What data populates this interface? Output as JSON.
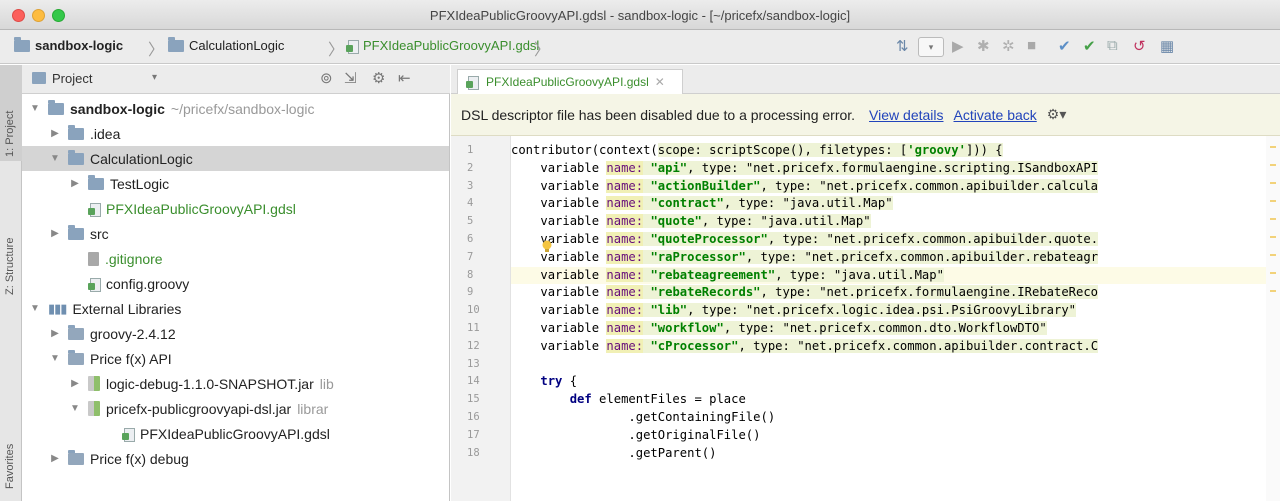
{
  "window": {
    "title": "PFXIdeaPublicGroovyAPI.gdsl - sandbox-logic - [~/pricefx/sandbox-logic]"
  },
  "breadcrumb": [
    "sandbox-logic",
    "CalculationLogic",
    "PFXIdeaPublicGroovyAPI.gdsl"
  ],
  "side_tabs": [
    "1: Project",
    "Z: Structure",
    "Favorites"
  ],
  "project_panel": {
    "header": "Project",
    "tree": [
      {
        "label": "sandbox-logic",
        "suffix": "~/pricefx/sandbox-logic"
      },
      {
        "label": ".idea"
      },
      {
        "label": "CalculationLogic"
      },
      {
        "label": "TestLogic"
      },
      {
        "label": "PFXIdeaPublicGroovyAPI.gdsl"
      },
      {
        "label": "src"
      },
      {
        "label": ".gitignore"
      },
      {
        "label": "config.groovy"
      },
      {
        "label": "External Libraries"
      },
      {
        "label": "groovy-2.4.12"
      },
      {
        "label": "Price f(x) API"
      },
      {
        "label": "logic-debug-1.1.0-SNAPSHOT.jar",
        "suffix": "lib"
      },
      {
        "label": "pricefx-publicgroovyapi-dsl.jar",
        "suffix": "librar"
      },
      {
        "label": "PFXIdeaPublicGroovyAPI.gdsl"
      },
      {
        "label": "Price f(x) debug"
      }
    ]
  },
  "editor": {
    "tab": "PFXIdeaPublicGroovyAPI.gdsl",
    "banner": {
      "message": "DSL descriptor file has been disabled due to a processing error.",
      "link1": "View details",
      "link2": "Activate back"
    },
    "line_numbers": [
      "1",
      "2",
      "3",
      "4",
      "5",
      "6",
      "7",
      "8",
      "9",
      "10",
      "11",
      "12",
      "13",
      "14",
      "15",
      "16",
      "17",
      "18"
    ],
    "line1": {
      "a": "contributor(context(",
      "b": "scope",
      "c": ": scriptScope(), ",
      "d": "filetypes",
      "e": ": [",
      "f": "'groovy'",
      "g": "])) {"
    },
    "variables": [
      {
        "kw": "variable",
        "name": "name:",
        "val": "\"api\"",
        "rest": ", type: \"net.pricefx.formulaengine.scripting.ISandboxAPI"
      },
      {
        "kw": "variable",
        "name": "name:",
        "val": "\"actionBuilder\"",
        "rest": ", type: \"net.pricefx.common.apibuilder.calcula"
      },
      {
        "kw": "variable",
        "name": "name:",
        "val": "\"contract\"",
        "rest": ", type: \"java.util.Map\""
      },
      {
        "kw": "variable",
        "name": "name:",
        "val": "\"quote\"",
        "rest": ", type: \"java.util.Map\""
      },
      {
        "kw": "variable",
        "name": "name:",
        "val": "\"quoteProcessor\"",
        "rest": ", type: \"net.pricefx.common.apibuilder.quote."
      },
      {
        "kw": "variable",
        "name": "name:",
        "val": "\"raProcessor\"",
        "rest": ", type: \"net.pricefx.common.apibuilder.rebateagr"
      },
      {
        "kw": "variable",
        "name": "name:",
        "val": "\"rebateagreement\"",
        "rest": ", type: \"java.util.Map\""
      },
      {
        "kw": "variable",
        "name": "name:",
        "val": "\"rebateRecords\"",
        "rest": ", type: \"net.pricefx.formulaengine.IRebateReco"
      },
      {
        "kw": "variable",
        "name": "name:",
        "val": "\"lib\"",
        "rest": ", type: \"net.pricefx.logic.idea.psi.PsiGroovyLibrary\""
      },
      {
        "kw": "variable",
        "name": "name:",
        "val": "\"workflow\"",
        "rest": ", type: \"net.pricefx.common.dto.WorkflowDTO\""
      },
      {
        "kw": "variable",
        "name": "name:",
        "val": "\"cProcessor\"",
        "rest": ", type: \"net.pricefx.common.apibuilder.contract.C"
      }
    ],
    "line14": {
      "kw": "try",
      "rest": " {"
    },
    "line15": {
      "kw": "def",
      "rest": " elementFiles = place"
    },
    "line16": ".getContainingFile()",
    "line17": ".getOriginalFile()",
    "line18": ".getParent()"
  }
}
